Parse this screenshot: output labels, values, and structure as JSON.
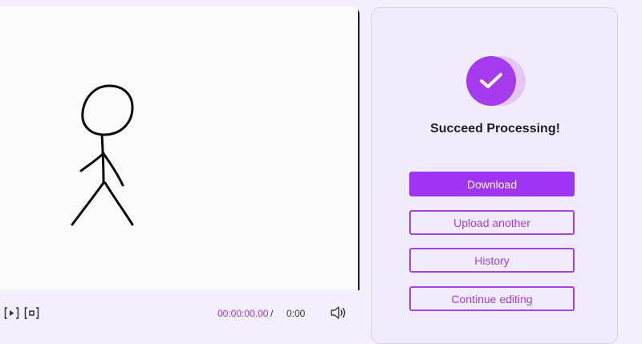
{
  "player": {
    "current_time": "00:00:00.00",
    "separator": "/",
    "total_time": "0:00",
    "controls": {
      "play_icon": "play-icon",
      "stop_icon": "stop-icon",
      "volume_icon": "volume-icon"
    }
  },
  "result": {
    "icon": "check-circle-icon",
    "title": "Succeed Processing!",
    "download_label": "Download",
    "upload_another_label": "Upload another",
    "history_label": "History",
    "continue_editing_label": "Continue editing"
  },
  "colors": {
    "accent": "#a53bec",
    "primary_button": "#9e34f4",
    "time_text": "#9b38e0",
    "panel_bg": "#f1ecfd",
    "page_bg": "#f4f1fd"
  }
}
